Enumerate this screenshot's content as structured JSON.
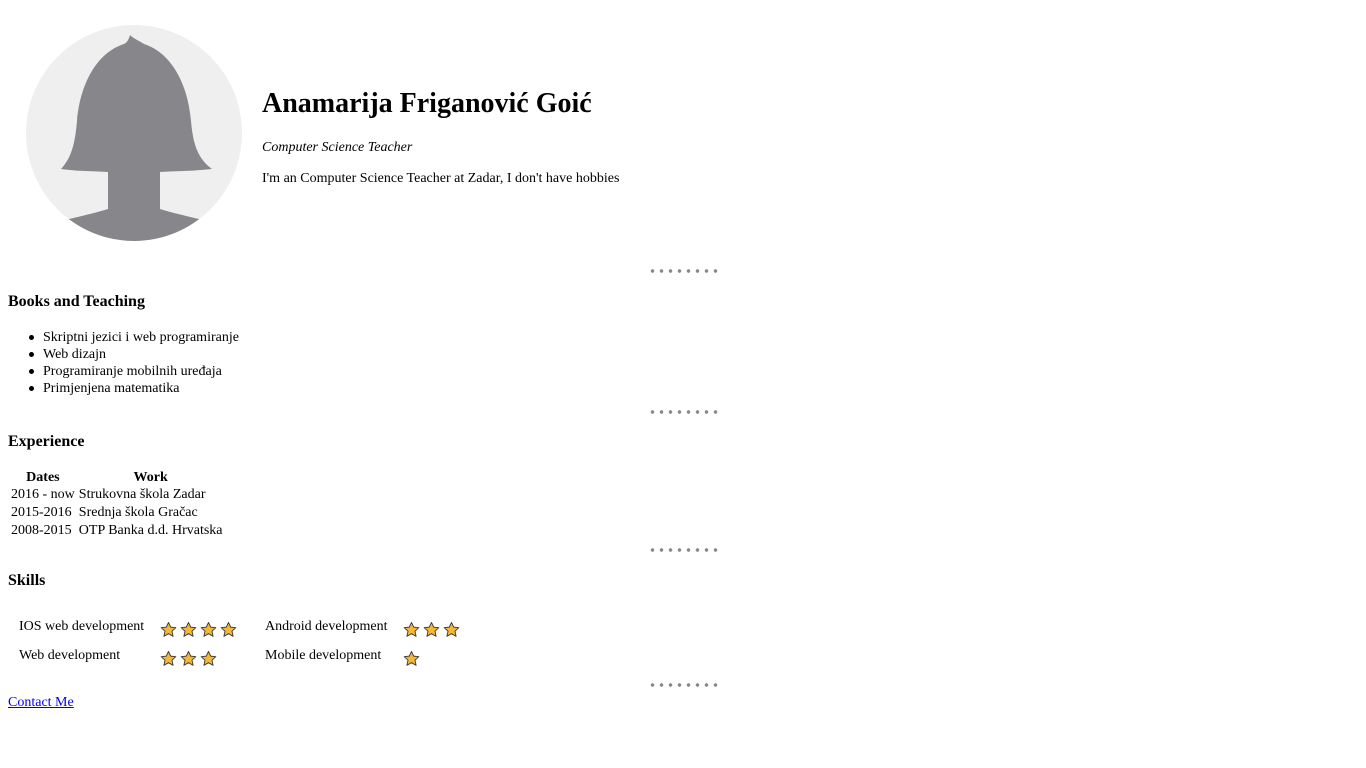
{
  "profile": {
    "avatar_icon": "female-user-placeholder-icon",
    "name": "Anamarija Friganović Goić",
    "role": "Computer Science Teacher",
    "bio": "I'm an Computer Science Teacher at Zadar, I don't have hobbies"
  },
  "books": {
    "title": "Books and Teaching",
    "items": [
      "Skriptni jezici i web programiranje",
      "Web dizajn",
      "Programiranje mobilnih uređaja",
      "Primjenjena matematika"
    ]
  },
  "experience": {
    "title": "Experience",
    "headers": [
      "Dates",
      "Work"
    ],
    "rows": [
      {
        "dates": "2016 - now",
        "work": "Strukovna škola Zadar"
      },
      {
        "dates": "2015-2016",
        "work": "Srednja škola Gračac"
      },
      {
        "dates": "2008-2015",
        "work": "OTP Banka d.d. Hrvatska"
      }
    ]
  },
  "skills": {
    "title": "Skills",
    "star_icon": "star-icon",
    "star_color": "#f5b836",
    "items": [
      {
        "label": "IOS web development",
        "stars": 4
      },
      {
        "label": "Android development",
        "stars": 3
      },
      {
        "label": "Web development",
        "stars": 3
      },
      {
        "label": "Mobile development",
        "stars": 1
      }
    ]
  },
  "contact": {
    "label": "Contact Me"
  },
  "colors": {
    "avatar_bg": "#efefef",
    "avatar_fg": "#87878b",
    "divider_dots": "#888888",
    "link": "#0000ee"
  }
}
